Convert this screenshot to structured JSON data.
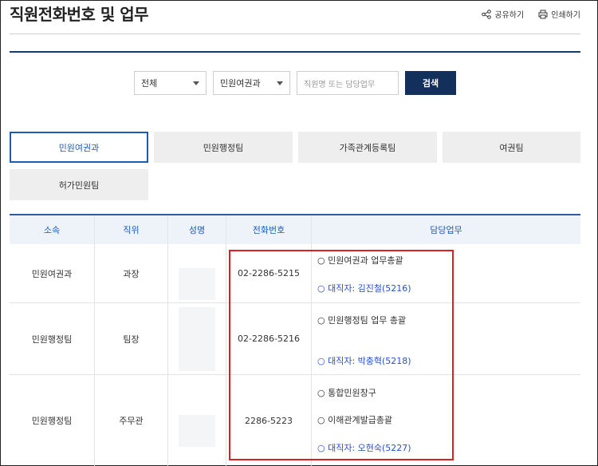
{
  "page": {
    "title": "직원전화번호 및 업무"
  },
  "actions": {
    "share": "공유하기",
    "print": "인쇄하기"
  },
  "search": {
    "scope": "전체",
    "department": "민원여권과",
    "placeholder": "직원명 또는 담당업무",
    "button": "검색"
  },
  "tabs": [
    "민원여권과",
    "민원행정팀",
    "가족관계등록팀",
    "여권팀",
    "허가민원팀"
  ],
  "table": {
    "headers": [
      "소속",
      "직위",
      "성명",
      "전화번호",
      "담당업무"
    ],
    "rows": [
      {
        "dept": "민원여권과",
        "position": "과장",
        "name": "",
        "phone": "02-2286-5215",
        "duties": [
          "○ 민원여권과 업무총괄",
          "○ 대직자: 김진철(5216)"
        ]
      },
      {
        "dept": "민원행정팀",
        "position": "팀장",
        "name": "",
        "phone": "02-2286-5216",
        "duties": [
          "○ 민원행정팀 업무 총괄",
          "○ 대직자: 박충혁(5218)"
        ]
      },
      {
        "dept": "민원행정팀",
        "position": "주무관",
        "name": "",
        "phone": "2286-5223",
        "duties": [
          "○ 통합민원창구",
          "○ 이해관계발급총괄",
          "○ 대직자: 오현숙(5227)"
        ]
      }
    ]
  },
  "colors": {
    "navy": "#13305c",
    "accent": "#1e5bb8",
    "highlight": "#e02020"
  }
}
